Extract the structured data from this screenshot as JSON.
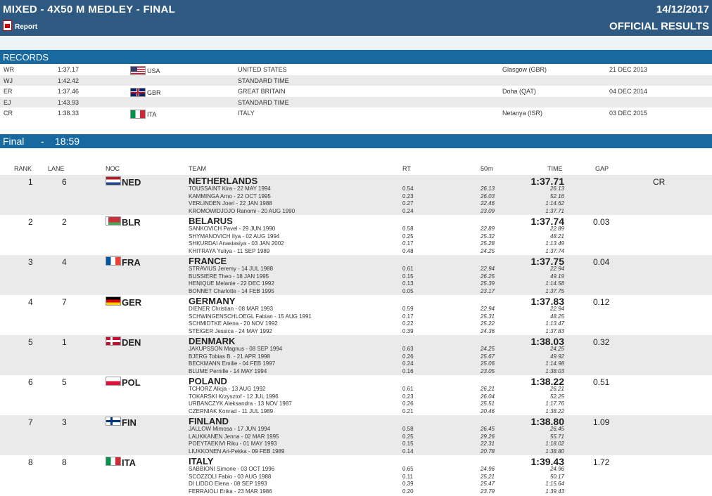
{
  "header": {
    "event_title": "MIXED - 4X50 M MEDLEY - FINAL",
    "date": "14/12/2017",
    "report_label": "Report",
    "official_label": "OFFICIAL RESULTS"
  },
  "records_section": {
    "title": "RECORDS",
    "rows": [
      {
        "code": "WR",
        "time": "1:37.17",
        "noc": "USA",
        "flag": "flag-usa",
        "team": "UNITED STATES",
        "place": "Glasgow (GBR)",
        "date": "21 DEC 2013"
      },
      {
        "code": "WJ",
        "time": "1:42.42",
        "noc": "",
        "flag": "",
        "team": "STANDARD TIME",
        "place": "",
        "date": ""
      },
      {
        "code": "ER",
        "time": "1:37.46",
        "noc": "GBR",
        "flag": "flag-gbr",
        "team": "GREAT BRITAIN",
        "place": "Doha (QAT)",
        "date": "04 DEC 2014"
      },
      {
        "code": "EJ",
        "time": "1:43.93",
        "noc": "",
        "flag": "",
        "team": "STANDARD TIME",
        "place": "",
        "date": ""
      },
      {
        "code": "CR",
        "time": "1:38.33",
        "noc": "ITA",
        "flag": "flag-ita",
        "team": "ITALY",
        "place": "Netanya (ISR)",
        "date": "03 DEC 2015"
      }
    ]
  },
  "final_section": {
    "title": "Final",
    "dash": "-",
    "time": "18:59",
    "columns": {
      "rank": "RANK",
      "lane": "LANE",
      "noc": "NOC",
      "team": "TEAM",
      "rt": "RT",
      "split": "50m",
      "time": "TIME",
      "gap": "GAP"
    },
    "results": [
      {
        "rank": "1",
        "lane": "6",
        "noc": "NED",
        "flag": "flag-ned",
        "team": "NETHERLANDS",
        "time": "1:37.71",
        "gap": "",
        "record": "CR",
        "swimmers": [
          {
            "name": "TOUSSAINT Kira - 22 MAY 1994",
            "rt": "0.54",
            "split": "26.13",
            "cum": "26.13"
          },
          {
            "name": "KAMMINGA Arno - 22 OCT 1995",
            "rt": "0.23",
            "split": "26.03",
            "cum": "52.16"
          },
          {
            "name": "VERLINDEN Joeri - 22 JAN 1988",
            "rt": "0.27",
            "split": "22.46",
            "cum": "1:14.62"
          },
          {
            "name": "KROMOWIDJOJO Ranomi - 20 AUG 1990",
            "rt": "0.24",
            "split": "23.09",
            "cum": "1:37.71"
          }
        ]
      },
      {
        "rank": "2",
        "lane": "2",
        "noc": "BLR",
        "flag": "flag-blr",
        "team": "BELARUS",
        "time": "1:37.74",
        "gap": "0.03",
        "record": "",
        "swimmers": [
          {
            "name": "SANKOVICH Pavel - 29 JUN 1990",
            "rt": "0.58",
            "split": "22.89",
            "cum": "22.89"
          },
          {
            "name": "SHYMANOVICH Ilya - 02 AUG 1994",
            "rt": "0.25",
            "split": "25.32",
            "cum": "48.21"
          },
          {
            "name": "SHKURDAI Anastasiya - 03 JAN 2002",
            "rt": "0.17",
            "split": "25.28",
            "cum": "1:13.49"
          },
          {
            "name": "KHITRAYA Yuliya - 11 SEP 1989",
            "rt": "0.48",
            "split": "24.25",
            "cum": "1:37.74"
          }
        ]
      },
      {
        "rank": "3",
        "lane": "4",
        "noc": "FRA",
        "flag": "flag-fra",
        "team": "FRANCE",
        "time": "1:37.75",
        "gap": "0.04",
        "record": "",
        "swimmers": [
          {
            "name": "STRAVIUS Jeremy - 14 JUL 1988",
            "rt": "0.61",
            "split": "22.94",
            "cum": "22.94"
          },
          {
            "name": "BUSSIERE Theo - 18 JAN 1995",
            "rt": "0.15",
            "split": "26.25",
            "cum": "49.19"
          },
          {
            "name": "HENIQUE Melanie - 22 DEC 1992",
            "rt": "0.13",
            "split": "25.39",
            "cum": "1:14.58"
          },
          {
            "name": "BONNET Charlotte - 14 FEB 1995",
            "rt": "0.05",
            "split": "23.17",
            "cum": "1:37.75"
          }
        ]
      },
      {
        "rank": "4",
        "lane": "7",
        "noc": "GER",
        "flag": "flag-ger",
        "team": "GERMANY",
        "time": "1:37.83",
        "gap": "0.12",
        "record": "",
        "swimmers": [
          {
            "name": "DIENER Christian - 08 MAR 1993",
            "rt": "0.59",
            "split": "22.94",
            "cum": "22.94"
          },
          {
            "name": "SCHWINGENSCHLOEGL Fabian - 15 AUG 1991",
            "rt": "0.17",
            "split": "25.31",
            "cum": "48.25"
          },
          {
            "name": "SCHMIDTKE Aliena - 20 NOV 1992",
            "rt": "0.22",
            "split": "25.22",
            "cum": "1:13.47"
          },
          {
            "name": "STEIGER Jessica - 24 MAY 1992",
            "rt": "0.39",
            "split": "24.36",
            "cum": "1:37.83"
          }
        ]
      },
      {
        "rank": "5",
        "lane": "1",
        "noc": "DEN",
        "flag": "flag-den",
        "team": "DENMARK",
        "time": "1:38.03",
        "gap": "0.32",
        "record": "",
        "swimmers": [
          {
            "name": "JAKUPSSON Magnus - 08 SEP 1994",
            "rt": "0.63",
            "split": "24.25",
            "cum": "24.25"
          },
          {
            "name": "BJERG Tobias B. - 21 APR 1998",
            "rt": "0.26",
            "split": "25.67",
            "cum": "49.92"
          },
          {
            "name": "BECKMANN Emilie - 04 FEB 1997",
            "rt": "0.24",
            "split": "25.06",
            "cum": "1:14.98"
          },
          {
            "name": "BLUME Pernille - 14 MAY 1994",
            "rt": "0.16",
            "split": "23.05",
            "cum": "1:38.03"
          }
        ]
      },
      {
        "rank": "6",
        "lane": "5",
        "noc": "POL",
        "flag": "flag-pol",
        "team": "POLAND",
        "time": "1:38.22",
        "gap": "0.51",
        "record": "",
        "swimmers": [
          {
            "name": "TCHORZ Alicja - 13 AUG 1992",
            "rt": "0.61",
            "split": "26.21",
            "cum": "26.21"
          },
          {
            "name": "TOKARSKI Krzysztof - 12 JUL 1996",
            "rt": "0.23",
            "split": "26.04",
            "cum": "52.25"
          },
          {
            "name": "URBANCZYK Aleksandra - 13 NOV 1987",
            "rt": "0.26",
            "split": "25.51",
            "cum": "1:17.76"
          },
          {
            "name": "CZERNIAK Konrad - 11 JUL 1989",
            "rt": "0.21",
            "split": "20.46",
            "cum": "1:38.22"
          }
        ]
      },
      {
        "rank": "7",
        "lane": "3",
        "noc": "FIN",
        "flag": "flag-fin",
        "team": "FINLAND",
        "time": "1:38.80",
        "gap": "1.09",
        "record": "",
        "swimmers": [
          {
            "name": "JALLOW Mimosa - 17 JUN 1994",
            "rt": "0.58",
            "split": "26.45",
            "cum": "26.45"
          },
          {
            "name": "LAUKKANEN Jenna - 02 MAR 1995",
            "rt": "0.25",
            "split": "29.26",
            "cum": "55.71"
          },
          {
            "name": "POEYTAEKIVI Riku - 01 MAY 1993",
            "rt": "0.15",
            "split": "22.31",
            "cum": "1:18.02"
          },
          {
            "name": "LIUKKONEN Ari-Pekka - 09 FEB 1989",
            "rt": "0.14",
            "split": "20.78",
            "cum": "1:38.80"
          }
        ]
      },
      {
        "rank": "8",
        "lane": "8",
        "noc": "ITA",
        "flag": "flag-ita",
        "team": "ITALY",
        "time": "1:39.43",
        "gap": "1.72",
        "record": "",
        "swimmers": [
          {
            "name": "SABBIONI Simone - 03 OCT 1996",
            "rt": "0.65",
            "split": "24.96",
            "cum": "24.96"
          },
          {
            "name": "SCOZZOLI Fabio - 03 AUG 1988",
            "rt": "0.11",
            "split": "25.21",
            "cum": "50.17"
          },
          {
            "name": "DI LIDDO Elena - 08 SEP 1993",
            "rt": "0.39",
            "split": "25.47",
            "cum": "1:15.64"
          },
          {
            "name": "FERRAIOLI Erika - 23 MAR 1986",
            "rt": "0.20",
            "split": "23.79",
            "cum": "1:39.43"
          }
        ]
      }
    ]
  }
}
